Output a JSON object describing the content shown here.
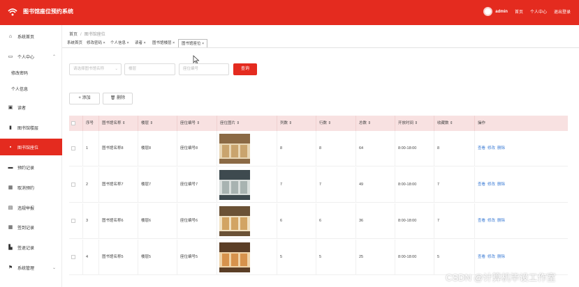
{
  "app": {
    "title": "图书馆座位预约系统"
  },
  "topbar": {
    "username": "admin",
    "links": [
      "首页",
      "个人中心",
      "退出登录"
    ]
  },
  "sidebar": {
    "items": [
      {
        "label": "系统首页",
        "icon": "home-icon"
      },
      {
        "label": "个人中心",
        "icon": "user-icon"
      },
      {
        "label": "读者",
        "icon": "reader-icon"
      },
      {
        "label": "图书馆楼层",
        "icon": "bar-chart-icon"
      },
      {
        "label": "图书馆座位",
        "icon": "seat-icon"
      },
      {
        "label": "预约记录",
        "icon": "calendar-icon"
      },
      {
        "label": "取消预约",
        "icon": "grid-icon"
      },
      {
        "label": "违规举报",
        "icon": "report-icon"
      },
      {
        "label": "签到记录",
        "icon": "grid-icon"
      },
      {
        "label": "签退记录",
        "icon": "signout-icon"
      },
      {
        "label": "系统管理",
        "icon": "flag-icon"
      }
    ],
    "subitems": [
      "修改密码",
      "个人信息"
    ]
  },
  "breadcrumb": {
    "home": "首页",
    "current": "图书馆座位"
  },
  "tabs": [
    "系统首页",
    "修改密码 ×",
    "个人信息 ×",
    "读者 ×",
    "图书馆楼层 ×",
    "图书馆座位 ×"
  ],
  "search": {
    "library_placeholder": "请选择图书馆名称",
    "floor_placeholder": "楼层",
    "seat_placeholder": "座位编号",
    "button": "查询"
  },
  "actions": {
    "add": "+ 添加",
    "delete": "删除"
  },
  "table": {
    "headers": [
      "序号",
      "图书馆名称",
      "楼层",
      "座位编号",
      "座位图片",
      "列数",
      "行数",
      "总数",
      "开放时间",
      "收藏数",
      "操作"
    ],
    "rows": [
      {
        "index": "1",
        "name": "图书馆名称8",
        "floor": "楼层8",
        "seat": "座位编号8",
        "cols": "8",
        "rows": "8",
        "total": "64",
        "hours": "8:00-18:00",
        "fav": "8"
      },
      {
        "index": "2",
        "name": "图书馆名称7",
        "floor": "楼层7",
        "seat": "座位编号7",
        "cols": "7",
        "rows": "7",
        "total": "49",
        "hours": "8:00-18:00",
        "fav": "7"
      },
      {
        "index": "3",
        "name": "图书馆名称6",
        "floor": "楼层6",
        "seat": "座位编号6",
        "cols": "6",
        "rows": "6",
        "total": "36",
        "hours": "8:00-18:00",
        "fav": "7"
      },
      {
        "index": "4",
        "name": "图书馆名称5",
        "floor": "楼层5",
        "seat": "座位编号5",
        "cols": "5",
        "rows": "5",
        "total": "25",
        "hours": "8:00-18:00",
        "fav": "5"
      }
    ],
    "ops": [
      "查看",
      "修改",
      "删除"
    ]
  },
  "watermark": "CSDN @计算机毕设工作室",
  "colors": {
    "primary": "#e42b1f",
    "header_row": "#f8e1e1",
    "link": "#3a7bd5"
  }
}
